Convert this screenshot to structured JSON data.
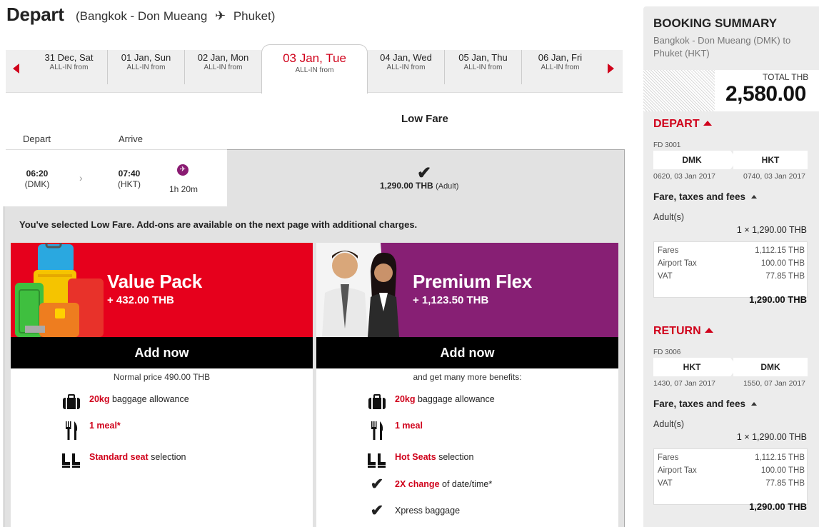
{
  "header": {
    "title": "Depart",
    "route_from": "(Bangkok - Don Mueang",
    "plane_glyph": "✈",
    "route_to": "Phuket)"
  },
  "dates": [
    {
      "date": "31 Dec, Sat",
      "sub": "ALL-IN from"
    },
    {
      "date": "01 Jan, Sun",
      "sub": "ALL-IN from"
    },
    {
      "date": "02 Jan, Mon",
      "sub": "ALL-IN from"
    },
    {
      "date": "03 Jan, Tue",
      "sub": "ALL-IN from",
      "active": true
    },
    {
      "date": "04 Jan, Wed",
      "sub": "ALL-IN from"
    },
    {
      "date": "05 Jan, Thu",
      "sub": "ALL-IN from"
    },
    {
      "date": "06 Jan, Fri",
      "sub": "ALL-IN from"
    }
  ],
  "table": {
    "fare_column": "Low Fare",
    "depart_label": "Depart",
    "arrive_label": "Arrive"
  },
  "flight": {
    "dep_time": "06:20",
    "dep_code": "(DMK)",
    "arr_time": "07:40",
    "arr_code": "(HKT)",
    "duration": "1h 20m",
    "price": "1,290.00 THB",
    "price_note": "(Adult)"
  },
  "addons": {
    "message": "You've selected Low Fare. Add-ons are available on the next page with additional charges.",
    "value_pack": {
      "title": "Value Pack",
      "price": "+ 432.00 THB",
      "button": "Add now",
      "sub": "Normal price 490.00 THB",
      "features": [
        {
          "hl": "20kg",
          "text": " baggage allowance"
        },
        {
          "hl": "1 meal*",
          "text": ""
        },
        {
          "hl": "Standard seat",
          "text": "  selection"
        }
      ]
    },
    "premium_flex": {
      "title": "Premium Flex",
      "price": "+ 1,123.50 THB",
      "button": "Add now",
      "sub": "and get many more benefits:",
      "features": [
        {
          "hl": "20kg",
          "text": " baggage allowance"
        },
        {
          "hl": "1 meal",
          "text": ""
        },
        {
          "hl": "Hot Seats",
          "text": " selection"
        },
        {
          "hl": "2X change",
          "text": " of date/time*"
        },
        {
          "hl": "",
          "text": "Xpress baggage"
        }
      ]
    }
  },
  "summary": {
    "title": "BOOKING SUMMARY",
    "route": "Bangkok - Don Mueang (DMK) to Phuket (HKT)",
    "total_label": "TOTAL THB",
    "total_value": "2,580.00",
    "depart": {
      "heading": "DEPART",
      "flight_no": "FD 3001",
      "from": "DMK",
      "to": "HKT",
      "from_time": "0620, 03 Jan 2017",
      "to_time": "0740, 03 Jan 2017",
      "fees_heading": "Fare, taxes and fees",
      "pax_label": "Adult(s)",
      "pax_value": "1 × 1,290.00 THB",
      "breakdown": [
        {
          "label": "Fares",
          "value": "1,112.15 THB"
        },
        {
          "label": "Airport Tax",
          "value": "100.00 THB"
        },
        {
          "label": "VAT",
          "value": "77.85 THB"
        }
      ],
      "subtotal": "1,290.00 THB"
    },
    "return": {
      "heading": "RETURN",
      "flight_no": "FD 3006",
      "from": "HKT",
      "to": "DMK",
      "from_time": "1430, 07 Jan 2017",
      "to_time": "1550, 07 Jan 2017",
      "fees_heading": "Fare, taxes and fees",
      "pax_label": "Adult(s)",
      "pax_value": "1 × 1,290.00 THB",
      "breakdown": [
        {
          "label": "Fares",
          "value": "1,112.15 THB"
        },
        {
          "label": "Airport Tax",
          "value": "100.00 THB"
        },
        {
          "label": "VAT",
          "value": "77.85 THB"
        }
      ],
      "subtotal": "1,290.00 THB"
    }
  }
}
